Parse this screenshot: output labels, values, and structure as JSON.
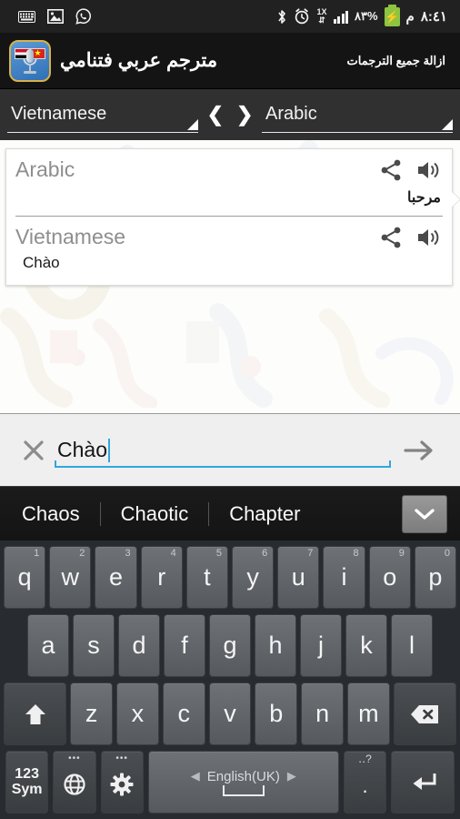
{
  "statusbar": {
    "left_icons": [
      "keyboard-icon",
      "image-icon",
      "whatsapp-icon"
    ],
    "bluetooth_icon": "bluetooth-icon",
    "alarm_icon": "alarm-icon",
    "data_icon_label": "1X",
    "signal_icon": "signal-icon",
    "battery_percent": "٨٣%",
    "battery_icon": "battery-charging-icon",
    "meridiem": "م",
    "time": "٨:٤١"
  },
  "appbar": {
    "icon_name": "app-icon-arabic-vietnamese-translator",
    "flag_left": "yemen-flag",
    "flag_right": "vietnam-flag",
    "vietnam_star": "★",
    "title": "مترجم عربي فتنامي",
    "action_label": "ازالة جميع الترجمات"
  },
  "langbar": {
    "source": "Vietnamese",
    "target": "Arabic",
    "prev_arrow": "❮",
    "next_arrow": "❯"
  },
  "result_card": {
    "entries": [
      {
        "language": "Arabic",
        "text": "مرحبا",
        "rtl": true,
        "share_icon": "share-icon",
        "speak_icon": "speaker-icon"
      },
      {
        "language": "Vietnamese",
        "text": "Chào",
        "rtl": false,
        "share_icon": "share-icon",
        "speak_icon": "speaker-icon"
      }
    ]
  },
  "inputbar": {
    "clear_icon": "close-x-icon",
    "value": "Chào",
    "placeholder": "",
    "submit_icon": "arrow-right-icon",
    "accent_color": "#33a6dd"
  },
  "suggestions": {
    "items": [
      "Chaos",
      "Chaotic",
      "Chapter"
    ],
    "expand_icon": "chevron-down-icon"
  },
  "keyboard": {
    "row1": [
      {
        "label": "q",
        "hint": "1"
      },
      {
        "label": "w",
        "hint": "2"
      },
      {
        "label": "e",
        "hint": "3"
      },
      {
        "label": "r",
        "hint": "4"
      },
      {
        "label": "t",
        "hint": "5"
      },
      {
        "label": "y",
        "hint": "6"
      },
      {
        "label": "u",
        "hint": "7"
      },
      {
        "label": "i",
        "hint": "8"
      },
      {
        "label": "o",
        "hint": "9"
      },
      {
        "label": "p",
        "hint": "0"
      }
    ],
    "row2": [
      {
        "label": "a"
      },
      {
        "label": "s"
      },
      {
        "label": "d"
      },
      {
        "label": "f"
      },
      {
        "label": "g"
      },
      {
        "label": "h"
      },
      {
        "label": "j"
      },
      {
        "label": "k"
      },
      {
        "label": "l"
      }
    ],
    "row3": [
      {
        "label": "z"
      },
      {
        "label": "x"
      },
      {
        "label": "c"
      },
      {
        "label": "v"
      },
      {
        "label": "b"
      },
      {
        "label": "n"
      },
      {
        "label": "m"
      }
    ],
    "shift_icon": "shift-arrow-up-icon",
    "backspace_icon": "backspace-icon",
    "sym_label_line1": "123",
    "sym_label_line2": "Sym",
    "globe_icon": "globe-icon",
    "settings_icon": "gear-icon",
    "space_label": "English(UK)",
    "space_prev_icon": "arrow-left-icon",
    "space_next_icon": "arrow-right-icon",
    "period_label": ".",
    "period_hint": "‥?",
    "enter_icon": "enter-return-icon"
  }
}
